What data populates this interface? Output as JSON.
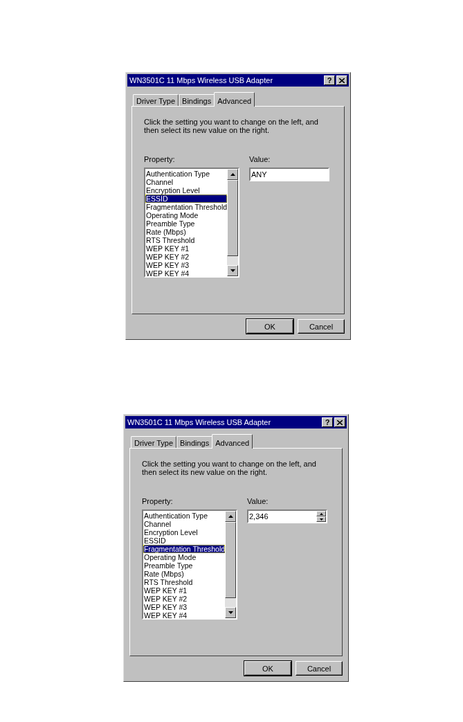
{
  "dialogs": [
    {
      "title": "WN3501C 11 Mbps Wireless USB Adapter",
      "help_button": "?",
      "tabs": [
        {
          "label": "Driver Type",
          "selected": false
        },
        {
          "label": "Bindings",
          "selected": false
        },
        {
          "label": "Advanced",
          "selected": true
        }
      ],
      "instruction": "Click the setting you want to change on the left, and then select its new value on the right.",
      "property_label": "Property:",
      "properties": [
        {
          "label": "Authentication Type",
          "selected": false
        },
        {
          "label": "Channel",
          "selected": false
        },
        {
          "label": "Encryption Level",
          "selected": false
        },
        {
          "label": "ESSID",
          "selected": true
        },
        {
          "label": "Fragmentation Threshold",
          "selected": false
        },
        {
          "label": "Operating Mode",
          "selected": false
        },
        {
          "label": "Preamble Type",
          "selected": false
        },
        {
          "label": "Rate (Mbps)",
          "selected": false
        },
        {
          "label": "RTS Threshold",
          "selected": false
        },
        {
          "label": "WEP KEY #1",
          "selected": false
        },
        {
          "label": "WEP KEY #2",
          "selected": false
        },
        {
          "label": "WEP KEY #3",
          "selected": false
        },
        {
          "label": "WEP KEY #4",
          "selected": false
        }
      ],
      "value_label": "Value:",
      "value": {
        "kind": "text",
        "text": "ANY"
      },
      "buttons": [
        "OK",
        "Cancel"
      ]
    },
    {
      "title": "WN3501C 11 Mbps Wireless USB Adapter",
      "help_button": "?",
      "tabs": [
        {
          "label": "Driver Type",
          "selected": false
        },
        {
          "label": "Bindings",
          "selected": false
        },
        {
          "label": "Advanced",
          "selected": true
        }
      ],
      "instruction": "Click the setting you want to change on the left, and then select its new value on the right.",
      "property_label": "Property:",
      "properties": [
        {
          "label": "Authentication Type",
          "selected": false
        },
        {
          "label": "Channel",
          "selected": false
        },
        {
          "label": "Encryption Level",
          "selected": false
        },
        {
          "label": "ESSID",
          "selected": false
        },
        {
          "label": "Fragmentation Threshold",
          "selected": true
        },
        {
          "label": "Operating Mode",
          "selected": false
        },
        {
          "label": "Preamble Type",
          "selected": false
        },
        {
          "label": "Rate (Mbps)",
          "selected": false
        },
        {
          "label": "RTS Threshold",
          "selected": false
        },
        {
          "label": "WEP KEY #1",
          "selected": false
        },
        {
          "label": "WEP KEY #2",
          "selected": false
        },
        {
          "label": "WEP KEY #3",
          "selected": false
        },
        {
          "label": "WEP KEY #4",
          "selected": false
        }
      ],
      "value_label": "Value:",
      "value": {
        "kind": "spin",
        "text": "2,346"
      },
      "buttons": [
        "OK",
        "Cancel"
      ]
    }
  ]
}
